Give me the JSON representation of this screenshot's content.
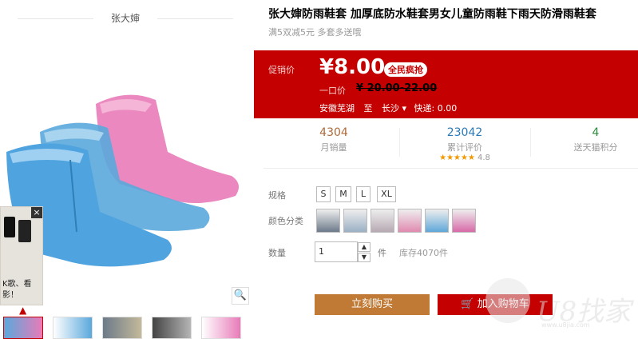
{
  "shop": {
    "name": "张大婶"
  },
  "ad": {
    "text_line1": "K歌、看",
    "text_line2": "影！",
    "close": "×"
  },
  "zoom_icon": "🔍",
  "thumb_scroll_up": "▲",
  "product": {
    "title": "张大婶防雨鞋套 加厚底防水鞋套男女儿童防雨鞋下雨天防滑雨鞋套",
    "subtitle": "满5双减5元 多套多送哦"
  },
  "price": {
    "promo_label": "促销价",
    "promo_value": "¥8.00",
    "badge": "全民疯抢",
    "original_label": "一口价",
    "original_value": "¥ 20.00-22.00",
    "ship_from": "安徽芜湖",
    "ship_to_word": "至",
    "ship_to": "长沙",
    "ship_dropdown": "▾",
    "shipping": "快递: 0.00"
  },
  "stats": [
    {
      "value": "4304",
      "label": "月销量",
      "color": "#b06a3a"
    },
    {
      "value": "23042",
      "label": "累计评价",
      "color": "#2a7ab8",
      "stars": "★★★★★",
      "rating": "4.8"
    },
    {
      "value": "4",
      "label": "送天猫积分",
      "color": "#2e8b3e"
    }
  ],
  "options": {
    "size_label": "规格",
    "sizes": [
      "S",
      "M",
      "L",
      "XL"
    ],
    "color_label": "颜色分类",
    "swatch_colors": [
      "#6c7a8a",
      "#9ab0c4",
      "#b7a9b3",
      "#e08ab0",
      "#5fa7d9",
      "#d86aa8"
    ],
    "qty_label": "数量",
    "qty_value": "1",
    "qty_unit": "件",
    "stock": "库存4070件"
  },
  "actions": {
    "buy_now": "立刻购买",
    "add_cart": "加入购物车",
    "cart_icon": "🛒"
  },
  "watermark": {
    "text": "U8找家",
    "url": "www.u8jia.com"
  }
}
